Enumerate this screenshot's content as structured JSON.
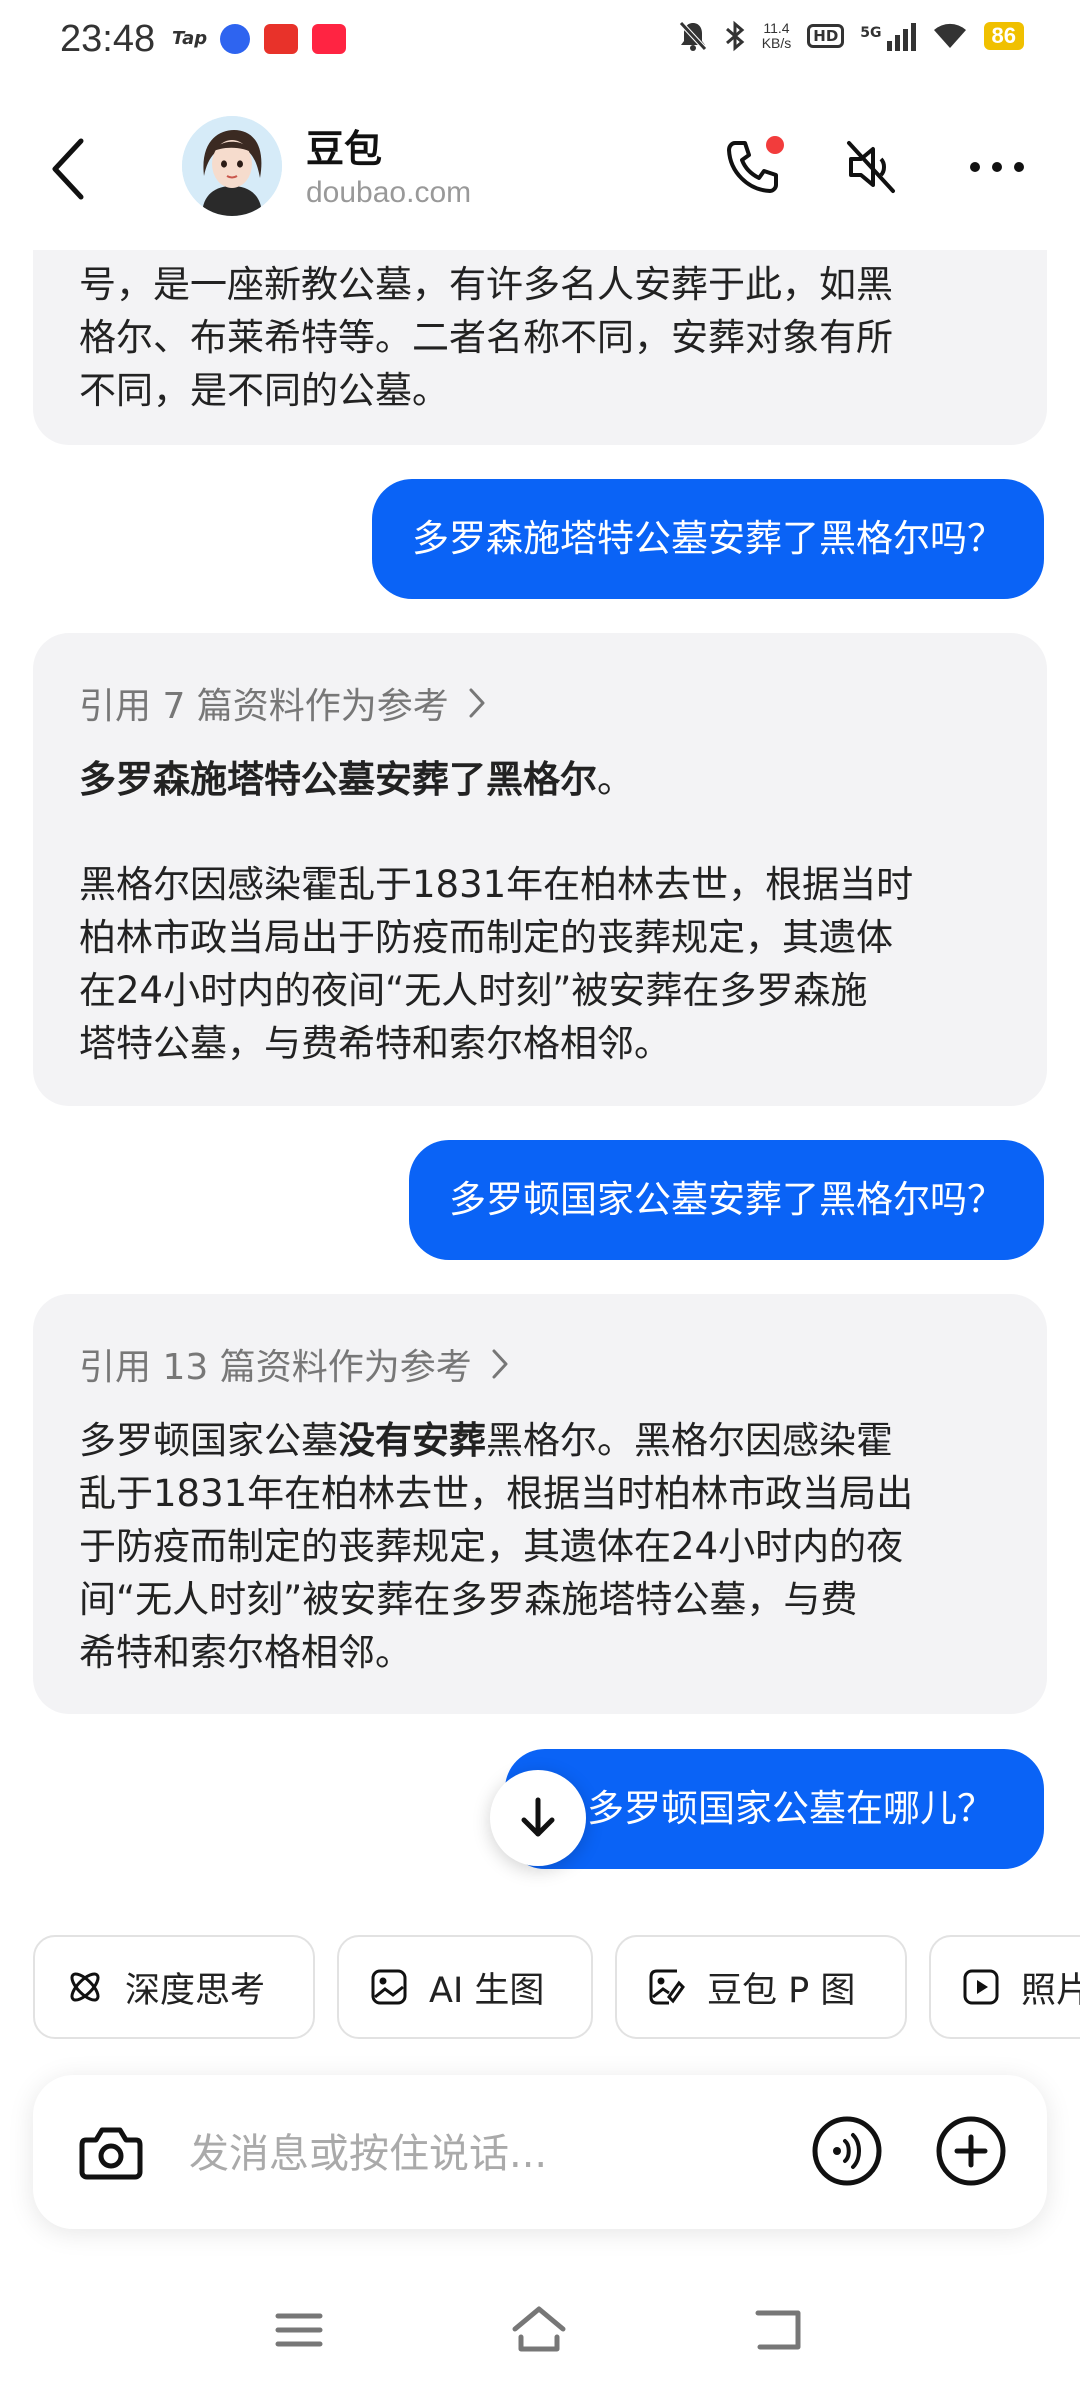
{
  "status_bar": {
    "time": "23:48",
    "app_icons": [
      "Tap",
      "baidu",
      "taobao",
      "xiaohongshu"
    ],
    "tap_label": "Tap",
    "net_speed_value": "11.4",
    "net_speed_unit": "KB/s",
    "hd_label": "HD",
    "signal_label": "5G",
    "battery": "86"
  },
  "header": {
    "name": "豆包",
    "subtitle": "doubao.com"
  },
  "messages": {
    "m0": {
      "lines": [
        "号，是一座新教公墓，有许多名人安葬于此，如黑",
        "格尔、布莱希特等。二者名称不同，安葬对象有所",
        "不同，是不同的公墓。"
      ]
    },
    "u1": {
      "text": "多罗森施塔特公墓安葬了黑格尔吗？"
    },
    "a1": {
      "ref": "引用 7 篇资料作为参考",
      "headline_bold": "多罗森施塔特公墓安葬了黑格尔",
      "headline_end": "。",
      "lines": [
        "黑格尔因感染霍乱于1831年在柏林去世，根据当时",
        "柏林市政当局出于防疫而制定的丧葬规定，其遗体",
        "在24小时内的夜间“无人时刻”被安葬在多罗森施",
        "塔特公墓，与费希特和索尔格相邻。"
      ]
    },
    "u2": {
      "text": "多罗顿国家公墓安葬了黑格尔吗？"
    },
    "a2": {
      "ref": "引用 13 篇资料作为参考",
      "line1_pre": "多罗顿国家公墓",
      "line1_bold": "没有安葬",
      "line1_post": "黑格尔。黑格尔因感染霍",
      "lines": [
        "乱于1831年在柏林去世，根据当时柏林市政当局出",
        "于防疫而制定的丧葬规定，其遗体在24小时内的夜",
        "间“无人时刻”被安葬在多罗森施塔特公墓，与费",
        "希特和索尔格相邻。"
      ]
    },
    "u3": {
      "text": "多罗顿国家公墓在哪儿？"
    }
  },
  "chips": [
    {
      "label": "深度思考",
      "icon": "atom-icon"
    },
    {
      "label": "AI 生图",
      "icon": "image-icon"
    },
    {
      "label": "豆包 P 图",
      "icon": "image-edit-icon"
    },
    {
      "label": "照片",
      "icon": "play-icon"
    }
  ],
  "input": {
    "placeholder": "发消息或按住说话..."
  },
  "colors": {
    "accent": "#0a63f6",
    "ai_bubble": "#f3f3f5",
    "notification_dot": "#f23c3c",
    "battery": "#f0c000"
  }
}
